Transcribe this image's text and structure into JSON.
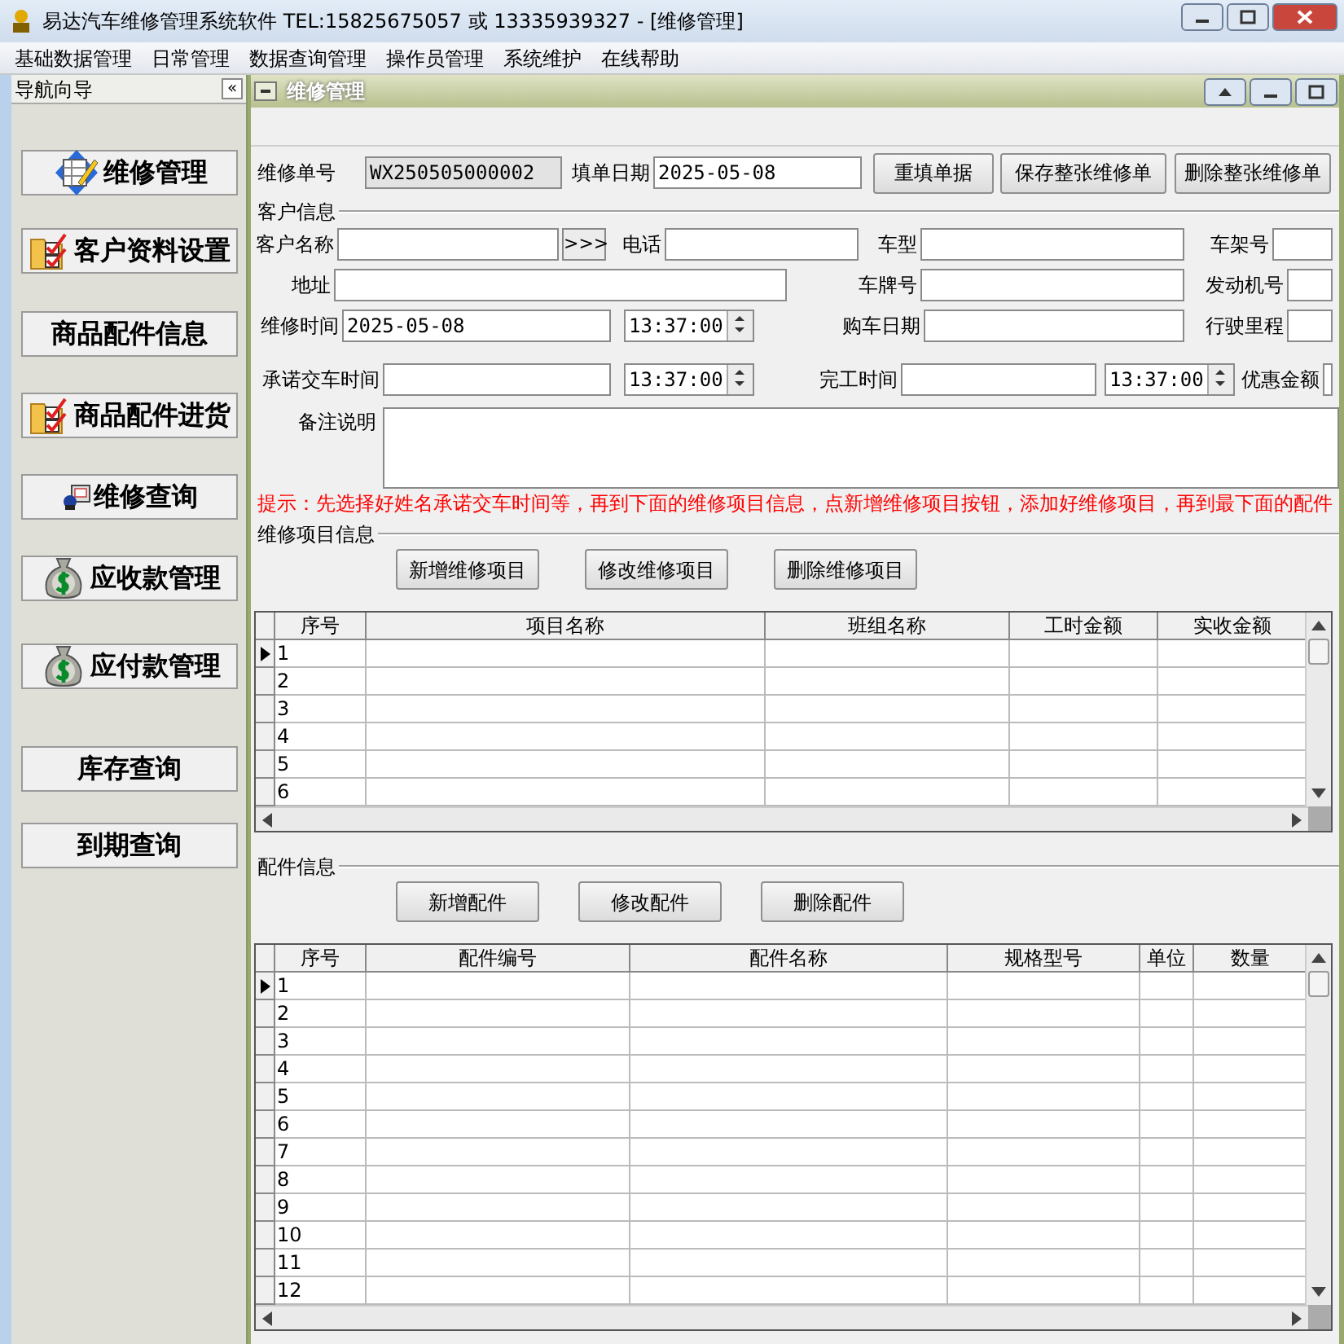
{
  "window": {
    "title": "易达汽车维修管理系统软件  TEL:15825675057 或 13335939327  - [维修管理]"
  },
  "menu": [
    "基础数据管理",
    "日常管理",
    "数据查询管理",
    "操作员管理",
    "系统维护",
    "在线帮助"
  ],
  "nav": {
    "title": "导航向导",
    "collapse": "«",
    "items": [
      {
        "label": "维修管理",
        "kind": "form"
      },
      {
        "label": "客户资料设置",
        "kind": "folder"
      },
      {
        "label": "商品配件信息",
        "kind": "plain"
      },
      {
        "label": "商品配件进货",
        "kind": "folder"
      },
      {
        "label": "维修查询",
        "kind": "computer"
      },
      {
        "label": "应收款管理",
        "kind": "moneybag"
      },
      {
        "label": "应付款管理",
        "kind": "moneybag"
      },
      {
        "label": "库存查询",
        "kind": "plain"
      },
      {
        "label": "到期查询",
        "kind": "plain"
      }
    ]
  },
  "child_window": {
    "title": "维修管理"
  },
  "order": {
    "number_label": "维修单号",
    "number": "WX250505000002",
    "date_label": "填单日期",
    "date": "2025-05-08",
    "buttons": [
      "重填单据",
      "保存整张维修单",
      "删除整张维修单"
    ]
  },
  "customer": {
    "title": "客户信息",
    "fields": [
      {
        "kind": "lookup",
        "label": "客户名称",
        "button": ">>>"
      },
      {
        "kind": "text",
        "label": "电话"
      },
      {
        "kind": "text",
        "label": "车型"
      },
      {
        "kind": "text",
        "label": "车架号"
      },
      {
        "kind": "text",
        "label": "地址"
      },
      {
        "kind": "text",
        "label": "车牌号"
      },
      {
        "kind": "text",
        "label": "发动机号"
      },
      {
        "kind": "datetime",
        "label": "维修时间",
        "value": "2025-05-08",
        "time": "13:37:00"
      },
      {
        "kind": "text",
        "label": "购车日期"
      },
      {
        "kind": "text",
        "label": "行驶里程"
      },
      {
        "kind": "datetime",
        "label": "承诺交车时间",
        "time": "13:37:00"
      },
      {
        "kind": "datetime",
        "label": "完工时间",
        "time": "13:37:00"
      },
      {
        "kind": "text",
        "label": "优惠金额"
      }
    ],
    "remark_label": "备注说明"
  },
  "hint": "提示：先选择好姓名承诺交车时间等，再到下面的维修项目信息，点新增维修项目按钮，添加好维修项目，再到最下面的配件",
  "items": {
    "title": "维修项目信息",
    "buttons": [
      "新增维修项目",
      "修改维修项目",
      "删除维修项目"
    ],
    "columns": [
      "序号",
      "项目名称",
      "班组名称",
      "工时金额",
      "实收金额"
    ],
    "rows": [
      {
        "no": "1",
        "current": true
      },
      {
        "no": "2",
        "current": false
      },
      {
        "no": "3",
        "current": false
      },
      {
        "no": "4",
        "current": false
      },
      {
        "no": "5",
        "current": false
      },
      {
        "no": "6",
        "current": false
      }
    ]
  },
  "parts": {
    "title": "配件信息",
    "buttons": [
      "新增配件",
      "修改配件",
      "删除配件"
    ],
    "columns": [
      "序号",
      "配件编号",
      "配件名称",
      "规格型号",
      "单位",
      "数量"
    ],
    "rows": [
      {
        "no": "1",
        "current": true
      },
      {
        "no": "2",
        "current": false
      },
      {
        "no": "3",
        "current": false
      },
      {
        "no": "4",
        "current": false
      },
      {
        "no": "5",
        "current": false
      },
      {
        "no": "6",
        "current": false
      },
      {
        "no": "7",
        "current": false
      },
      {
        "no": "8",
        "current": false
      },
      {
        "no": "9",
        "current": false
      },
      {
        "no": "10",
        "current": false
      },
      {
        "no": "11",
        "current": false
      },
      {
        "no": "12",
        "current": false
      }
    ]
  }
}
